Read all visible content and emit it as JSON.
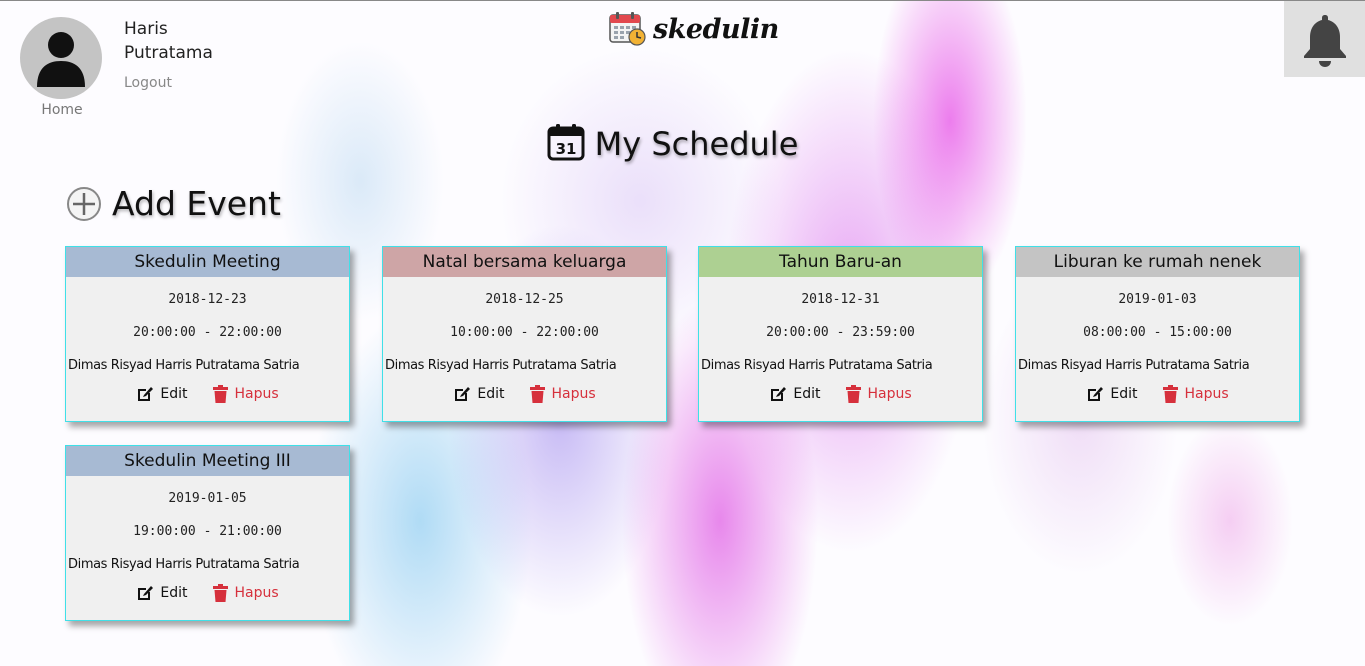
{
  "header": {
    "user_name": "Haris Putratama",
    "logout_label": "Logout",
    "home_label": "Home",
    "brand": "skedulin"
  },
  "page_title": "My Schedule",
  "add_event_label": "Add Event",
  "events": [
    {
      "title": "Skedulin Meeting",
      "date": "2018-12-23",
      "time": "20:00:00 - 22:00:00",
      "members": "Dimas Risyad Harris Putratama Satria",
      "color": "#a7bad3"
    },
    {
      "title": "Natal bersama keluarga",
      "date": "2018-12-25",
      "time": "10:00:00 - 22:00:00",
      "members": "Dimas Risyad Harris Putratama Satria",
      "color": "#cea5a6"
    },
    {
      "title": "Tahun Baru-an",
      "date": "2018-12-31",
      "time": "20:00:00 - 23:59:00",
      "members": "Dimas Risyad Harris Putratama Satria",
      "color": "#add092"
    },
    {
      "title": "Liburan ke rumah nenek",
      "date": "2019-01-03",
      "time": "08:00:00 - 15:00:00",
      "members": "Dimas Risyad Harris Putratama Satria",
      "color": "#c4c4c4"
    },
    {
      "title": "Skedulin Meeting III",
      "date": "2019-01-05",
      "time": "19:00:00 - 21:00:00",
      "members": "Dimas Risyad Harris Putratama Satria",
      "color": "#a7bad3"
    }
  ],
  "actions": {
    "edit_label": "Edit",
    "delete_label": "Hapus"
  },
  "icons": {
    "avatar": "user-avatar-icon",
    "logo": "calendar-clock-icon",
    "bell": "bell-icon",
    "title": "calendar-31-icon",
    "add": "plus-circle-icon",
    "edit": "edit-icon",
    "delete": "trash-icon"
  },
  "colors": {
    "card_border": "#3fe0e8",
    "delete_red": "#d6303c"
  }
}
